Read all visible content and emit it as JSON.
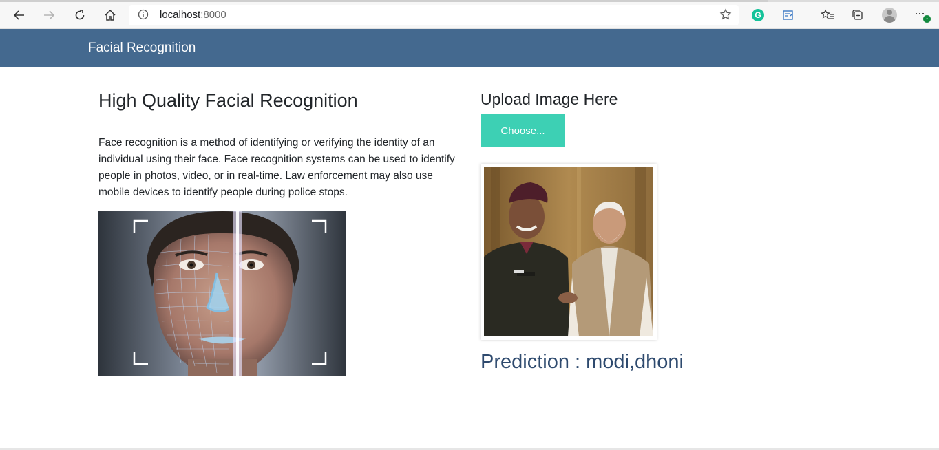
{
  "browser": {
    "url_host": "localhost",
    "url_port": ":8000",
    "icons": [
      "back-icon",
      "forward-icon",
      "refresh-icon",
      "home-icon",
      "info-icon",
      "favorite-star-icon",
      "grammarly-icon",
      "read-aloud-icon",
      "favorites-icon",
      "collections-icon",
      "profile-icon",
      "more-icon"
    ]
  },
  "navbar": {
    "brand": "Facial Recognition",
    "color": "#44698f"
  },
  "left": {
    "title": "High Quality Facial Recognition",
    "description": "Face recognition is a method of identifying or verifying the identity of an individual using their face. Face recognition systems can be used to identify people in photos, video, or in real-time. Law enforcement may also use mobile devices to identify people during police stops."
  },
  "right": {
    "upload_title": "Upload Image Here",
    "choose_label": "Choose...",
    "choose_color": "#3dd0b4",
    "prediction": "Prediction : modi,dhoni"
  }
}
